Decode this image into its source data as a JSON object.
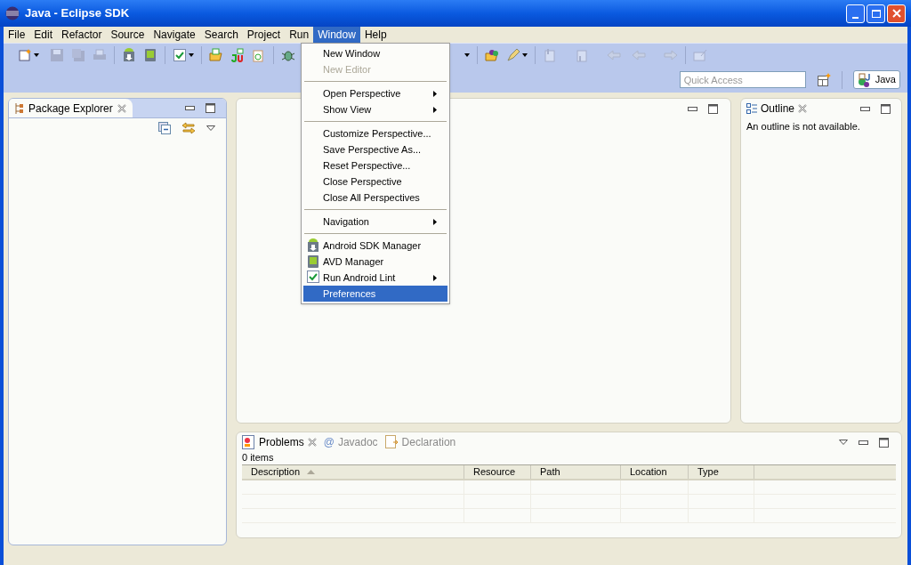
{
  "window": {
    "title": "Java - Eclipse SDK"
  },
  "menu_bar": [
    {
      "label": "File",
      "selected": false
    },
    {
      "label": "Edit",
      "selected": false
    },
    {
      "label": "Refactor",
      "selected": false
    },
    {
      "label": "Source",
      "selected": false
    },
    {
      "label": "Navigate",
      "selected": false
    },
    {
      "label": "Search",
      "selected": false
    },
    {
      "label": "Project",
      "selected": false
    },
    {
      "label": "Run",
      "selected": false
    },
    {
      "label": "Window",
      "selected": true
    },
    {
      "label": "Help",
      "selected": false
    }
  ],
  "window_menu": [
    {
      "kind": "item",
      "label": "New Window",
      "disabled": false,
      "submenu": false,
      "selected": false
    },
    {
      "kind": "item",
      "label": "New Editor",
      "disabled": true,
      "submenu": false,
      "selected": false
    },
    {
      "kind": "separator"
    },
    {
      "kind": "item",
      "label": "Open Perspective",
      "disabled": false,
      "submenu": true,
      "selected": false
    },
    {
      "kind": "item",
      "label": "Show View",
      "disabled": false,
      "submenu": true,
      "selected": false
    },
    {
      "kind": "separator"
    },
    {
      "kind": "item",
      "label": "Customize Perspective...",
      "disabled": false,
      "submenu": false,
      "selected": false
    },
    {
      "kind": "item",
      "label": "Save Perspective As...",
      "disabled": false,
      "submenu": false,
      "selected": false
    },
    {
      "kind": "item",
      "label": "Reset Perspective...",
      "disabled": false,
      "submenu": false,
      "selected": false
    },
    {
      "kind": "item",
      "label": "Close Perspective",
      "disabled": false,
      "submenu": false,
      "selected": false
    },
    {
      "kind": "item",
      "label": "Close All Perspectives",
      "disabled": false,
      "submenu": false,
      "selected": false
    },
    {
      "kind": "separator"
    },
    {
      "kind": "item",
      "label": "Navigation",
      "disabled": false,
      "submenu": true,
      "selected": false
    },
    {
      "kind": "separator"
    },
    {
      "kind": "sdk",
      "label": "Android SDK Manager",
      "disabled": false,
      "submenu": false,
      "selected": false
    },
    {
      "kind": "avd",
      "label": "AVD Manager",
      "disabled": false,
      "submenu": false,
      "selected": false
    },
    {
      "kind": "lint",
      "label": "Run Android Lint",
      "disabled": false,
      "submenu": true,
      "selected": false
    },
    {
      "kind": "item",
      "label": "Preferences",
      "disabled": false,
      "submenu": false,
      "selected": true
    }
  ],
  "quick_access": {
    "placeholder": "Quick Access"
  },
  "perspective": {
    "label": "Java"
  },
  "package_explorer": {
    "title": "Package Explorer"
  },
  "outline": {
    "title": "Outline",
    "message": "An outline is not available."
  },
  "problems": {
    "tabs": [
      {
        "label": "Problems",
        "selected": true,
        "kind": "problems"
      },
      {
        "label": "Javadoc",
        "selected": false,
        "kind": "javadoc",
        "symbol": "@"
      },
      {
        "label": "Declaration",
        "selected": false,
        "kind": "declaration"
      }
    ],
    "count": "0 items",
    "columns": [
      "Description",
      "Resource",
      "Path",
      "Location",
      "Type"
    ]
  }
}
